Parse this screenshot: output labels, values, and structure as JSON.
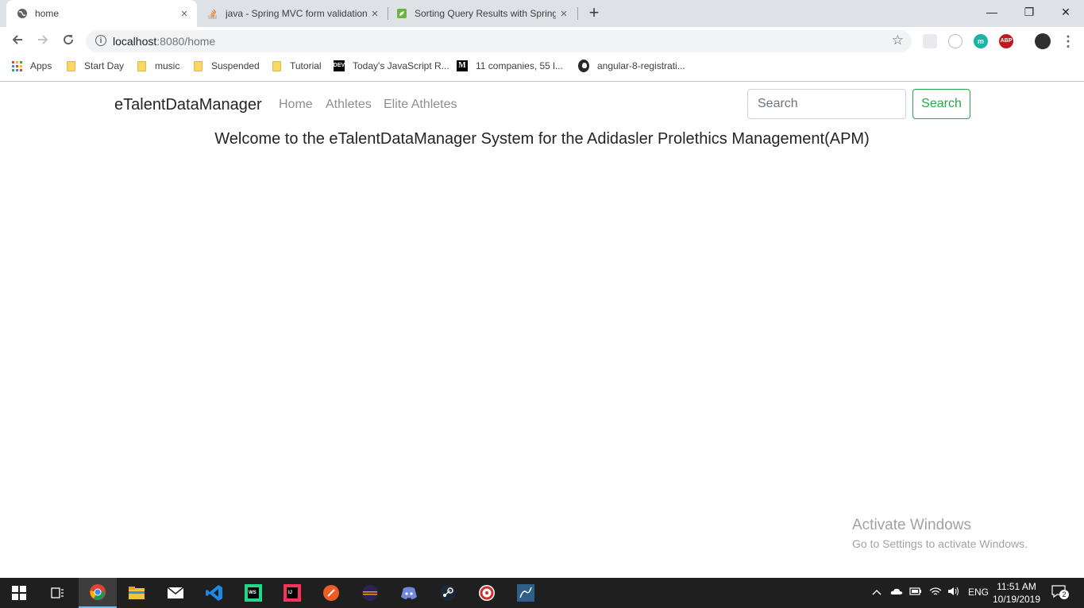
{
  "browser": {
    "tabs": [
      {
        "title": "home",
        "close": "×"
      },
      {
        "title": "java - Spring MVC form validation",
        "close": "×"
      },
      {
        "title": "Sorting Query Results with Spring",
        "close": "×"
      }
    ],
    "new_tab": "+",
    "window_controls": {
      "minimize": "—",
      "maximize": "❐",
      "close": "✕"
    },
    "url_host": "localhost",
    "url_path": ":8080/home",
    "bookmarks": [
      {
        "label": "Apps",
        "icon": "apps-grid-icon"
      },
      {
        "label": "Start Day",
        "icon": "folder-icon"
      },
      {
        "label": "music",
        "icon": "folder-icon"
      },
      {
        "label": "Suspended",
        "icon": "folder-icon"
      },
      {
        "label": "Tutorial",
        "icon": "folder-icon"
      },
      {
        "label": "Today's JavaScript R...",
        "icon": "dev-icon",
        "icon_text": "DEV"
      },
      {
        "label": "11 companies, 55 l...",
        "icon": "medium-icon",
        "icon_text": "M"
      },
      {
        "label": "angular-8-registrati...",
        "icon": "github-icon"
      }
    ],
    "extensions": {
      "m": "m",
      "abp": "ABP"
    }
  },
  "navbar": {
    "brand": "eTalentDataManager",
    "links": [
      "Home",
      "Athletes",
      "Elite Athletes"
    ],
    "search_placeholder": "Search",
    "search_button": "Search"
  },
  "main": {
    "welcome": "Welcome to the eTalentDataManager System for the Adidasler Prolethics Management(APM)"
  },
  "watermark": {
    "title": "Activate Windows",
    "subtitle": "Go to Settings to activate Windows."
  },
  "taskbar": {
    "language": "ENG",
    "time": "11:51 AM",
    "date": "10/19/2019",
    "notifications": "2"
  },
  "colors": {
    "accent_success": "#28a745",
    "taskbar_bg": "#1f1f1f",
    "tabstrip_bg": "#dee1e6"
  }
}
